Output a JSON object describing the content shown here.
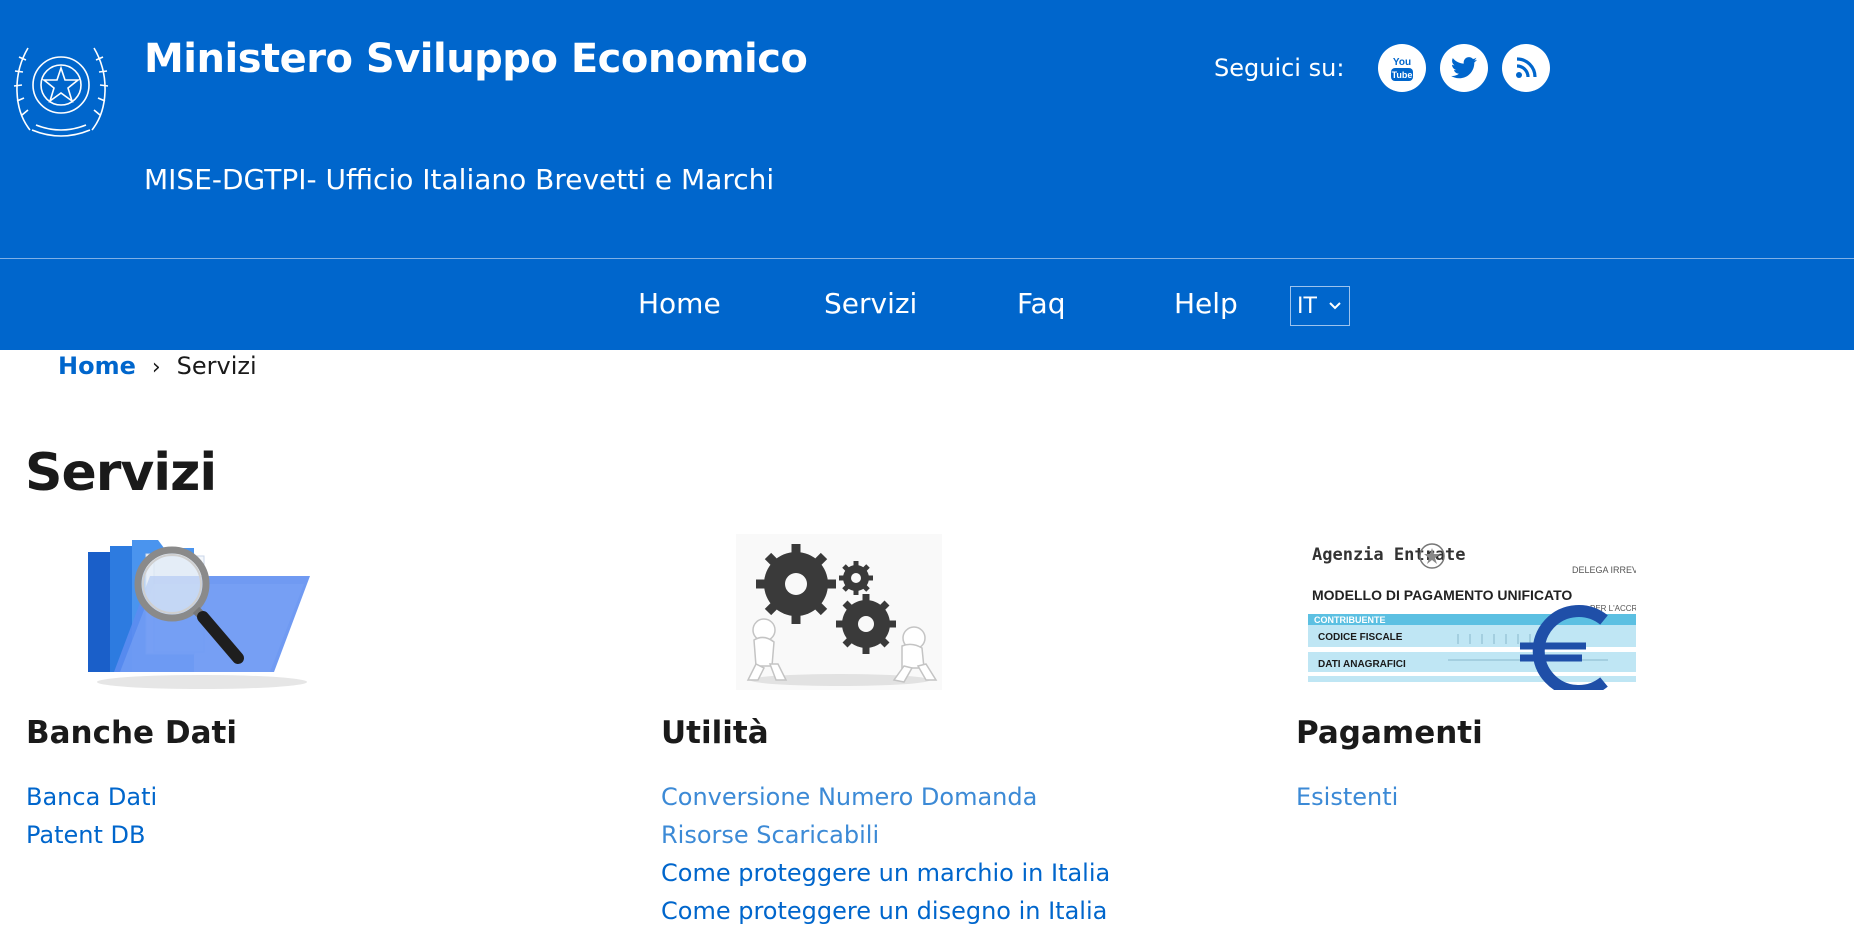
{
  "header": {
    "title": "Ministero Sviluppo Economico",
    "subtitle": "MISE-DGTPI- Ufficio Italiano Brevetti e Marchi",
    "emblem_icon": "italian-republic-emblem",
    "social": {
      "label": "Seguici su:",
      "icons": [
        "youtube-icon",
        "twitter-icon",
        "rss-icon"
      ]
    }
  },
  "nav": {
    "items": [
      "Home",
      "Servizi",
      "Faq",
      "Help"
    ],
    "language": {
      "selected": "IT"
    }
  },
  "breadcrumb": {
    "home": "Home",
    "separator": "›",
    "current": "Servizi"
  },
  "page": {
    "title": "Servizi"
  },
  "cards": [
    {
      "heading": "Banche Dati",
      "image": "folders-magnifier-image",
      "links": [
        "Banca Dati",
        "Patent DB"
      ]
    },
    {
      "heading": "Utilità",
      "image": "gears-figures-image",
      "links": [
        "Conversione Numero Domanda",
        "Risorse Scaricabili",
        "Come proteggere un marchio in Italia",
        "Come proteggere un disegno in Italia"
      ]
    },
    {
      "heading": "Pagamenti",
      "image": "f24-payment-form-image",
      "image_text": {
        "agency": "Agenzia Entrate",
        "form_title": "MODELLO DI PAGAMENTO UNIFICATO",
        "corner": "DELEGA IRREVC",
        "for": "PER L'ACCR",
        "section": "CONTRIBUENTE",
        "row1": "CODICE FISCALE",
        "row2": "DATI ANAGRAFICI"
      },
      "links": [
        "Esistenti"
      ]
    }
  ],
  "colors": {
    "brand_blue": "#0066cc",
    "link": "#0066cc",
    "link_light": "#3c8ad6"
  }
}
